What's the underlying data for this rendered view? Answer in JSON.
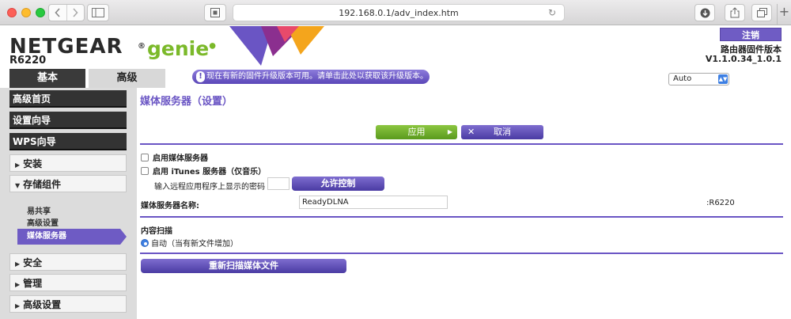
{
  "browser": {
    "url": "192.168.0.1/adv_index.htm",
    "back_icon": "chevron-left-icon",
    "forward_icon": "chevron-right-icon",
    "new_tab_icon": "plus-icon",
    "new_tab": "+"
  },
  "header": {
    "brand": "NETGEAR",
    "brand_suffix": "genie",
    "model": "R6220",
    "logout_label": "注销",
    "fw_label": "路由器固件版本",
    "fw_version": "V1.1.0.34_1.0.1",
    "tabs": [
      {
        "label": "基本"
      },
      {
        "label": "高级"
      }
    ],
    "update_notice": "现在有新的固件升级版本可用。请单击此处以获取该升级版本。",
    "language": "Auto",
    "colors": {
      "accent": "#6a55c4",
      "brand_green": "#7bb92a"
    }
  },
  "sidebar": {
    "items": [
      {
        "label": "高级首页"
      },
      {
        "label": "设置向导"
      },
      {
        "label": "WPS向导"
      },
      {
        "label": "安装"
      },
      {
        "label": "存储组件"
      },
      {
        "label": "安全"
      },
      {
        "label": "管理"
      },
      {
        "label": "高级设置"
      }
    ],
    "sub_items": [
      {
        "label": "易共享"
      },
      {
        "label": "高级设置"
      },
      {
        "label": "媒体服务器"
      }
    ]
  },
  "main": {
    "title": "媒体服务器（设置）",
    "apply_label": "应用",
    "cancel_label": "取消",
    "enable_media_server": "启用媒体服务器",
    "enable_itunes": "启用 iTunes 服务器（仅音乐）",
    "remote_password_label": "输入远程应用程序上显示的密码",
    "allow_control_label": "允许控制",
    "server_name_label": "媒体服务器名称:",
    "server_name_value": "ReadyDLNA",
    "server_name_suffix": ":R6220",
    "content_scan_title": "内容扫描",
    "auto_scan_label": "自动（当有新文件增加）",
    "rescan_label": "重新扫描媒体文件"
  }
}
